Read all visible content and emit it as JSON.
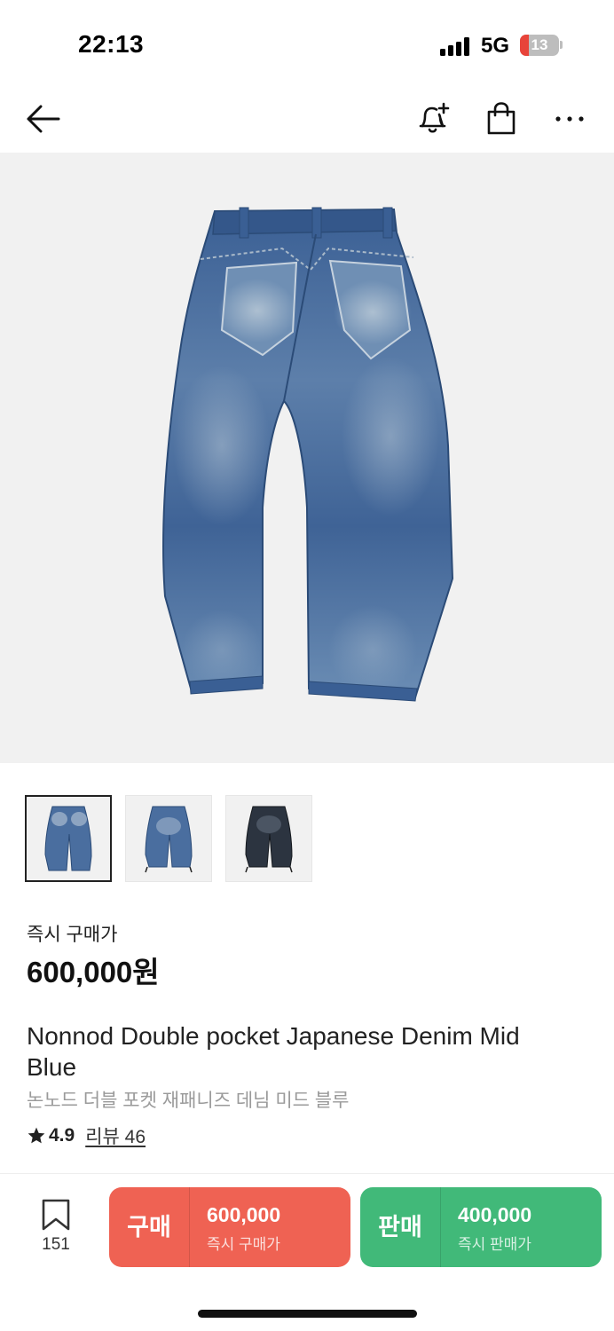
{
  "status_bar": {
    "time": "22:13",
    "network": "5G",
    "battery_level": "13",
    "battery_color": "#e8443a"
  },
  "nav": {
    "back_icon": "arrow-left-icon",
    "alert_icon": "bell-plus-icon",
    "bag_icon": "shopping-bag-icon",
    "more_icon": "more-horizontal-icon"
  },
  "gallery": {
    "selected_index": 0,
    "thumbnails": [
      {
        "variant": "mid-blue-front",
        "selected": true
      },
      {
        "variant": "mid-blue-back",
        "selected": false
      },
      {
        "variant": "dark-wash",
        "selected": false
      }
    ]
  },
  "product": {
    "price_label": "즉시 구매가",
    "price": "600,000원",
    "title_en": "Nonnod Double pocket Japanese Denim Mid Blue",
    "title_ko": "논노드 더블 포켓 재패니즈 데님 미드 블루",
    "rating_icon": "star-icon",
    "rating": "4.9",
    "review_label": "리뷰 46"
  },
  "bottom_bar": {
    "wish_icon": "bookmark-icon",
    "wish_count": "151",
    "buy": {
      "label": "구매",
      "price": "600,000",
      "sub_label": "즉시 구매가",
      "color": "#ef6253"
    },
    "sell": {
      "label": "판매",
      "price": "400,000",
      "sub_label": "즉시 판매가",
      "color": "#41b979"
    }
  }
}
